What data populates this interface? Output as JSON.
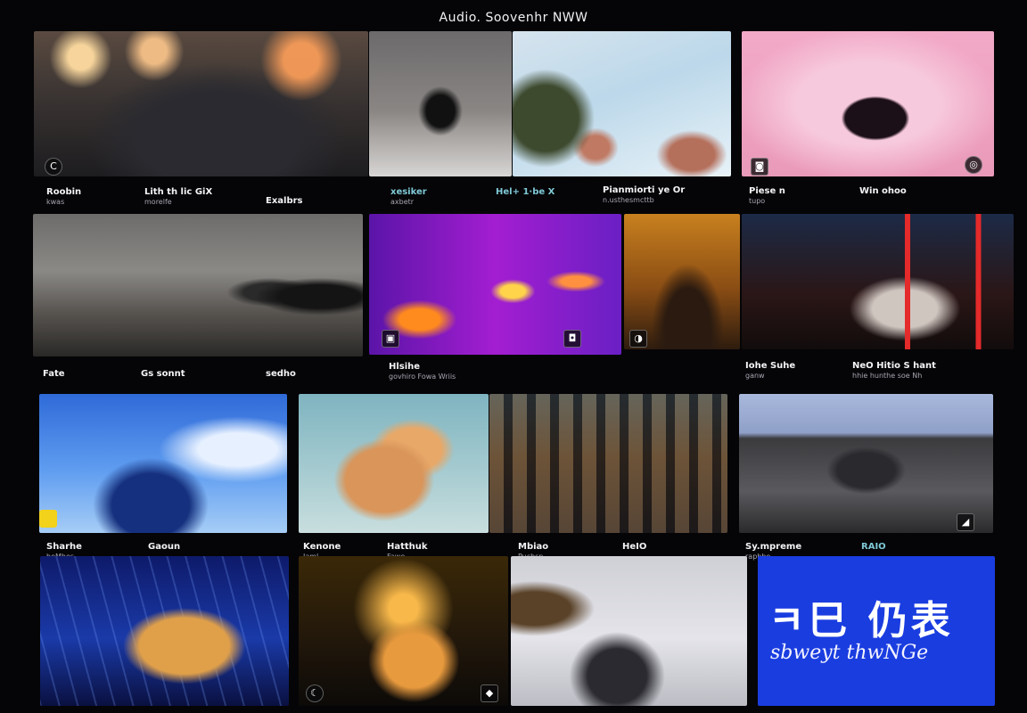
{
  "page": {
    "title": "Audio. Soovenhr NWW"
  },
  "row1": {
    "captions": [
      {
        "title": "Roobin",
        "sub": "kwas"
      },
      {
        "title": "Lith th lic GiX",
        "sub": "morelfe"
      },
      {
        "title": "Exalbrs",
        "sub": ""
      },
      {
        "title": "xesiker",
        "sub": "axbetr"
      },
      {
        "title": "Hel+ 1·be X",
        "sub": ""
      },
      {
        "title": "Pianmiorti ye Or",
        "sub": "n.usthesmcttb"
      },
      {
        "title": "Piese n",
        "sub": "tupo"
      },
      {
        "title": "Win ohoo",
        "sub": ""
      }
    ]
  },
  "row2": {
    "captions": [
      {
        "title": "Fate",
        "sub": ""
      },
      {
        "title": "Gs sonnt",
        "sub": ""
      },
      {
        "title": "sedho",
        "sub": ""
      },
      {
        "title": "Hlsihe",
        "sub": "govhiro Fowa Wriis"
      },
      {
        "title": "Iohe Suhe",
        "sub": "ganw"
      },
      {
        "title": "NeO Hitio S hant",
        "sub": "hhie hunthe soe Nh"
      }
    ]
  },
  "row3": {
    "captions": [
      {
        "title": "Sharhe",
        "sub": "heMhes"
      },
      {
        "title": "Gaoun",
        "sub": ""
      },
      {
        "title": "Kenone",
        "sub": "Jaml"
      },
      {
        "title": "Hatthuk",
        "sub": "Fawe"
      },
      {
        "title": "Mbiao",
        "sub": "Puchsn"
      },
      {
        "title": "HeIO",
        "sub": ""
      },
      {
        "title": "Sy.mpreme",
        "sub": "rapbhe"
      },
      {
        "title": "RAIO",
        "sub": ""
      }
    ]
  },
  "promo": {
    "main": "ㅋ巳 仍表",
    "sub": "sbweyt thwNGe"
  },
  "badges": {
    "r1a": "C",
    "r1b": "◙",
    "r1c": "◎",
    "r2a": "▣",
    "r2b": "◘",
    "r2c": "◑",
    "r3a": "◢",
    "r4a": "☾",
    "r4b": "◆"
  },
  "icons": {
    "badge": "play-badge-icon"
  }
}
